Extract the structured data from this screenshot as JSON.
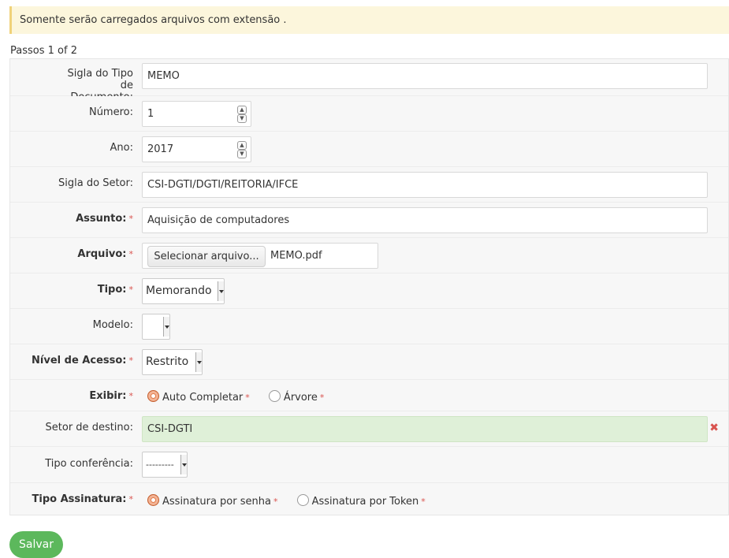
{
  "alert": {
    "text": "Somente serão carregados arquivos com extensão ."
  },
  "steps": "Passos 1 of 2",
  "required_mark": "*",
  "fields": {
    "sigla_tipo": {
      "label": "Sigla do Tipo de Documento:",
      "value": "MEMO"
    },
    "numero": {
      "label": "Número:",
      "value": "1"
    },
    "ano": {
      "label": "Ano:",
      "value": "2017"
    },
    "sigla_setor": {
      "label": "Sigla do Setor:",
      "value": "CSI-DGTI/DGTI/REITORIA/IFCE"
    },
    "assunto": {
      "label": "Assunto:",
      "value": "Aquisição de computadores"
    },
    "arquivo": {
      "label": "Arquivo:",
      "button": "Selecionar arquivo...",
      "filename": "MEMO.pdf"
    },
    "tipo": {
      "label": "Tipo:",
      "value": "Memorando"
    },
    "modelo": {
      "label": "Modelo:",
      "value": ""
    },
    "nivel_acesso": {
      "label": "Nível de Acesso:",
      "value": "Restrito"
    },
    "exibir": {
      "label": "Exibir:",
      "option1": "Auto Completar",
      "option2": "Árvore",
      "selected": "Auto Completar"
    },
    "setor_destino": {
      "label": "Setor de destino:",
      "value": "CSI-DGTI"
    },
    "tipo_conferencia": {
      "label": "Tipo conferência:",
      "value": "---------"
    },
    "tipo_assinatura": {
      "label": "Tipo Assinatura:",
      "option1": "Assinatura por senha",
      "option2": "Assinatura por Token",
      "selected": "Assinatura por senha"
    }
  },
  "buttons": {
    "save": "Salvar"
  },
  "icons": {
    "spinner": "spin-arrows-icon",
    "clear": "close-x-icon",
    "radio_selected": "radio-selected-icon",
    "radio_unselected": "radio-unselected-icon"
  },
  "colors": {
    "alert_bg": "#fcf6dc",
    "alert_border": "#f0d27a",
    "required": "#d9534f",
    "success_field": "#dff0d8",
    "save_button": "#5cb85c",
    "radio_selected": "#e07a4a"
  }
}
